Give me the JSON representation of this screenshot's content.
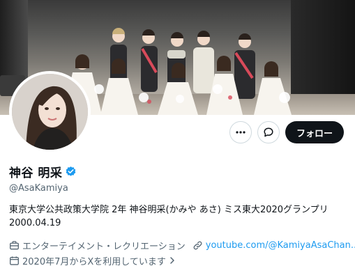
{
  "banner": {
    "alt": ""
  },
  "actions": {
    "more_icon": "more-horizontal-icon",
    "message_icon": "message-bubble-icon",
    "follow_label": "フォロー"
  },
  "profile": {
    "name": "神谷 明采",
    "verified_icon": "verified-badge-icon",
    "verified_color": "#1d9bf0",
    "handle": "@AsaKamiya",
    "bio_line1": "東京大学公共政策大学院 2年 神谷明采(かみや あさ) ミス東大2020グランプリ",
    "bio_line2": "2000.04.19",
    "category": "エンターテイメント・レクリエーション",
    "link_text": "youtube.com/@KamiyaAsaChan...",
    "joined": "2020年7月からXを利用しています",
    "accent_color": "#1d9bf0"
  }
}
